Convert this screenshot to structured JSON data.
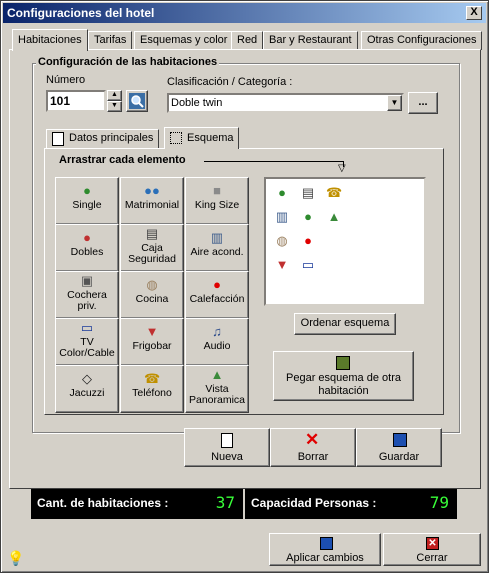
{
  "window": {
    "title": "Configuraciones del hotel",
    "close_glyph": "X"
  },
  "tabs": [
    "Habitaciones",
    "Tarifas",
    "Esquemas y color",
    "Red",
    "Bar y Restaurant",
    "Otras Configuraciones"
  ],
  "group": {
    "title": "Configuración de las habitaciones"
  },
  "numero": {
    "label": "Número",
    "value": "101"
  },
  "clasificacion": {
    "label": "Clasificación / Categoría :",
    "value": "Doble twin",
    "more": "..."
  },
  "subtabs": [
    "Datos principales",
    "Esquema"
  ],
  "drag": {
    "title": "Arrastrar cada elemento"
  },
  "elements": [
    {
      "label": "Single",
      "icon": "person-icon"
    },
    {
      "label": "Matrimonial",
      "icon": "couple-icon"
    },
    {
      "label": "King Size",
      "icon": "cube-icon"
    },
    {
      "label": "Dobles",
      "icon": "two-persons-icon"
    },
    {
      "label": "Caja\nSeguridad",
      "icon": "safe-icon"
    },
    {
      "label": "Aire acond.",
      "icon": "air-conditioner-icon"
    },
    {
      "label": "Cochera\npriv.",
      "icon": "garage-icon"
    },
    {
      "label": "Cocina",
      "icon": "pot-icon"
    },
    {
      "label": "Calefacción",
      "icon": "heater-icon"
    },
    {
      "label": "TV\nColor/Cable",
      "icon": "tv-icon"
    },
    {
      "label": "Frigobar",
      "icon": "cocktail-icon"
    },
    {
      "label": "Audio",
      "icon": "music-icon"
    },
    {
      "label": "Jacuzzi",
      "icon": "jacuzzi-icon"
    },
    {
      "label": "Teléfono",
      "icon": "phone-icon"
    },
    {
      "label": "Vista\nPanoramica",
      "icon": "landscape-icon"
    }
  ],
  "buttons": {
    "ordenar": "Ordenar esquema",
    "pegar": "Pegar esquema de otra habitación",
    "nueva": "Nueva",
    "borrar": "Borrar",
    "guardar": "Guardar",
    "aplicar": "Aplicar cambios",
    "cerrar": "Cerrar"
  },
  "status": {
    "habitaciones_label": "Cant. de habitaciones :",
    "habitaciones_value": "37",
    "capacidad_label": "Capacidad Personas :",
    "capacidad_value": "79"
  },
  "colors": {
    "titlebar": "#0a246a",
    "status_bg": "#000000",
    "status_value": "#38ff38"
  }
}
